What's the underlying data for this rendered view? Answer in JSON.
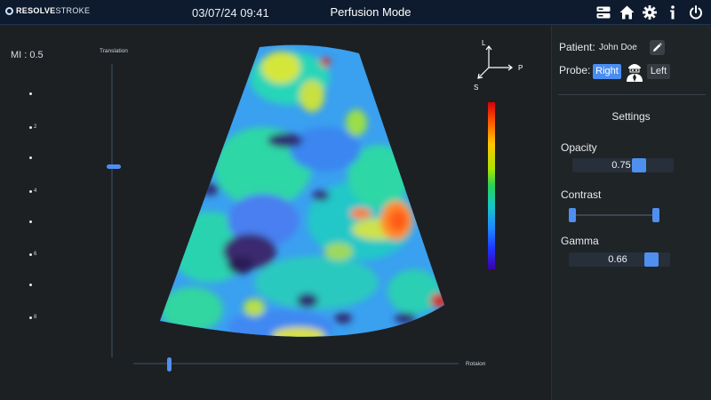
{
  "header": {
    "logo_bold": "RESOLVE",
    "logo_light": "STROKE",
    "datetime": "03/07/24 09:41",
    "mode": "Perfusion Mode",
    "icons": [
      "server-icon",
      "home-icon",
      "gear-icon",
      "info-icon",
      "power-icon"
    ]
  },
  "scale": {
    "mi_label": "MI : 0.5",
    "depth_ticks": [
      "",
      "2",
      "",
      "4",
      "",
      "6",
      "",
      "8"
    ]
  },
  "controls": {
    "translation_label": "Translation",
    "rotation_label": "Rotaion"
  },
  "orientation": {
    "up": "L",
    "right": "P",
    "down": "S"
  },
  "panel": {
    "patient_label": "Patient:",
    "patient_name": "John Doe",
    "probe_label": "Probe:",
    "probe_right": "Right",
    "probe_left": "Left",
    "settings_title": "Settings",
    "opacity_label": "Opacity",
    "opacity_value": "0.75",
    "contrast_label": "Contrast",
    "gamma_label": "Gamma",
    "gamma_value": "0.66"
  },
  "colors": {
    "accent": "#4f8ff0",
    "topbar": "#0e1b2e",
    "colorbar": [
      "#d4000c",
      "#ff5b00",
      "#ffc800",
      "#a9e400",
      "#28d15b",
      "#17c7c4",
      "#1d8bff",
      "#1f33ff",
      "#3d00a8"
    ]
  }
}
